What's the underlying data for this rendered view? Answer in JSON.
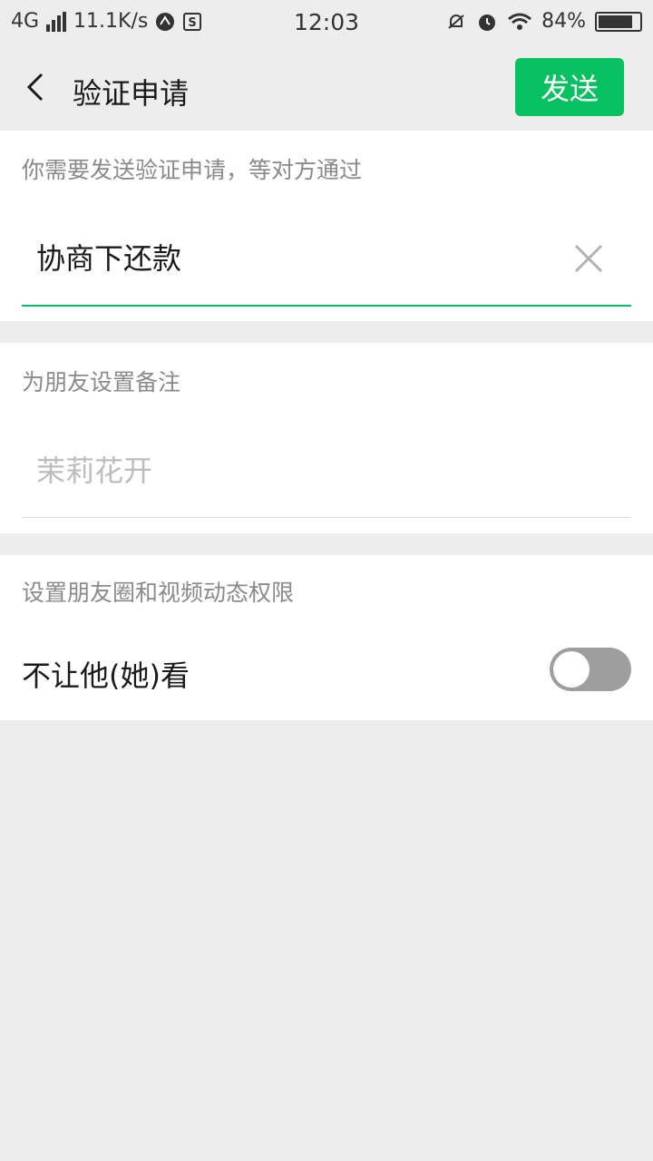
{
  "status_bar": {
    "network": "4G",
    "speed": "11.1K/s",
    "time": "12:03",
    "battery": "84%",
    "battery_level": 0.84
  },
  "nav": {
    "title": "验证申请",
    "send_label": "发送"
  },
  "verify": {
    "label": "你需要发送验证申请，等对方通过",
    "value": "协商下还款"
  },
  "remark": {
    "label": "为朋友设置备注",
    "placeholder": "茉莉花开"
  },
  "moments": {
    "label": "设置朋友圈和视频动态权限",
    "toggle_label": "不让他(她)看",
    "toggle_on": false
  },
  "colors": {
    "accent": "#07c160",
    "toggle_off": "#9e9e9e"
  }
}
